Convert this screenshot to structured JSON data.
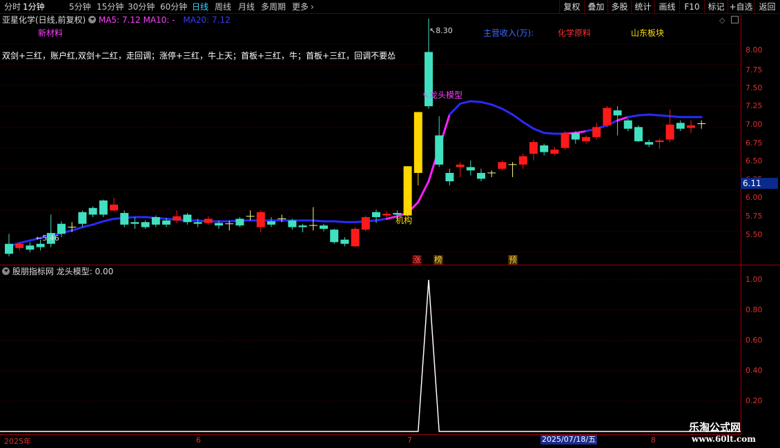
{
  "toolbar": {
    "periods": [
      "分时",
      "1分钟",
      "5分钟",
      "15分钟",
      "30分钟",
      "60分钟",
      "日线",
      "周线",
      "月线",
      "多周期",
      "更多"
    ],
    "active_period": "日线",
    "more_icon": "chevron-right-icon",
    "right_buttons": [
      "复权",
      "叠加",
      "多股",
      "统计",
      "画线",
      "F10",
      "标记",
      "+自选",
      "返回"
    ]
  },
  "main_panel": {
    "stock_title": "亚星化学(日线,前复权)",
    "ma5": "MA5: 7.12",
    "ma10": "MA10: -",
    "ma20": "MA20: 7.12",
    "tag_left": "新材料",
    "tags": [
      {
        "text": "主营收入(万):",
        "color": "#3a6bff"
      },
      {
        "text": "化学原料",
        "color": "#ff3030"
      },
      {
        "text": "山东板块",
        "color": "#ffe000"
      }
    ],
    "description": "双剑+三红，账户红,双剑+二红，走回调；涨停+三红，牛上天；首板+三红，牛；首板+三红，回调不要怂",
    "high_label": "8.30",
    "low_label": "5.46",
    "dragon_label": "龙头模型",
    "institution_label": "机构",
    "markers": [
      {
        "text": "涨",
        "bg": "#5a0000",
        "color": "#ff6060"
      },
      {
        "text": "榜",
        "bg": "#3a2a00",
        "color": "#ffd040"
      },
      {
        "text": "预",
        "bg": "#3a2a00",
        "color": "#ffd040"
      }
    ],
    "price_axis": [
      "8.00",
      "7.75",
      "7.50",
      "7.25",
      "7.00",
      "6.75",
      "6.50",
      "6.25",
      "6.00",
      "5.75",
      "5.50"
    ],
    "current_price": "6.11"
  },
  "indicator_panel": {
    "title": "股朋指标网",
    "indicator": "龙头模型: 0.00",
    "axis": [
      "1.00",
      "0.80",
      "0.60",
      "0.40",
      "0.20"
    ]
  },
  "x_axis": {
    "labels": [
      "2025年",
      "6",
      "7",
      "8"
    ],
    "selected_date": "2025/07/18/五"
  },
  "watermark": {
    "name": "乐淘公式网",
    "url": "www.60lt.com"
  },
  "chart_data": {
    "type": "candlestick",
    "ylim": [
      5.35,
      8.35
    ],
    "candles": [
      {
        "o": 5.6,
        "c": 5.48,
        "h": 5.72,
        "l": 5.45
      },
      {
        "o": 5.55,
        "c": 5.6,
        "h": 5.62,
        "l": 5.52
      },
      {
        "o": 5.58,
        "c": 5.53,
        "h": 5.62,
        "l": 5.5
      },
      {
        "o": 5.6,
        "c": 5.56,
        "h": 5.65,
        "l": 5.52
      },
      {
        "o": 5.73,
        "c": 5.6,
        "h": 5.95,
        "l": 5.56
      },
      {
        "o": 5.84,
        "c": 5.72,
        "h": 5.87,
        "l": 5.68
      },
      {
        "o": 5.8,
        "c": 5.8,
        "h": 5.86,
        "l": 5.74
      },
      {
        "o": 5.98,
        "c": 5.84,
        "h": 6.0,
        "l": 5.8
      },
      {
        "o": 6.03,
        "c": 5.95,
        "h": 6.05,
        "l": 5.92
      },
      {
        "o": 6.12,
        "c": 5.95,
        "h": 6.13,
        "l": 5.92
      },
      {
        "o": 6.0,
        "c": 6.07,
        "h": 6.15,
        "l": 5.99
      },
      {
        "o": 5.97,
        "c": 5.83,
        "h": 6.0,
        "l": 5.8
      },
      {
        "o": 5.86,
        "c": 5.84,
        "h": 5.92,
        "l": 5.78
      },
      {
        "o": 5.86,
        "c": 5.8,
        "h": 5.88,
        "l": 5.78
      },
      {
        "o": 5.92,
        "c": 5.83,
        "h": 5.94,
        "l": 5.8
      },
      {
        "o": 5.88,
        "c": 5.83,
        "h": 5.91,
        "l": 5.8
      },
      {
        "o": 5.88,
        "c": 5.93,
        "h": 6.0,
        "l": 5.85
      },
      {
        "o": 5.95,
        "c": 5.86,
        "h": 5.97,
        "l": 5.83
      },
      {
        "o": 5.86,
        "c": 5.84,
        "h": 5.9,
        "l": 5.8
      },
      {
        "o": 5.85,
        "c": 5.9,
        "h": 5.93,
        "l": 5.83
      },
      {
        "o": 5.85,
        "c": 5.82,
        "h": 5.88,
        "l": 5.78
      },
      {
        "o": 5.84,
        "c": 5.84,
        "h": 5.88,
        "l": 5.76
      },
      {
        "o": 5.9,
        "c": 5.82,
        "h": 5.92,
        "l": 5.8
      },
      {
        "o": 5.93,
        "c": 5.93,
        "h": 6.0,
        "l": 5.88
      },
      {
        "o": 5.8,
        "c": 5.98,
        "h": 6.0,
        "l": 5.74
      },
      {
        "o": 5.87,
        "c": 5.83,
        "h": 5.92,
        "l": 5.8
      },
      {
        "o": 5.9,
        "c": 5.9,
        "h": 5.95,
        "l": 5.86
      },
      {
        "o": 5.88,
        "c": 5.8,
        "h": 5.9,
        "l": 5.77
      },
      {
        "o": 5.82,
        "c": 5.8,
        "h": 5.84,
        "l": 5.74
      },
      {
        "o": 5.82,
        "c": 5.82,
        "h": 6.04,
        "l": 5.76
      },
      {
        "o": 5.82,
        "c": 5.78,
        "h": 5.84,
        "l": 5.75
      },
      {
        "o": 5.77,
        "c": 5.62,
        "h": 5.78,
        "l": 5.6
      },
      {
        "o": 5.65,
        "c": 5.6,
        "h": 5.68,
        "l": 5.57
      },
      {
        "o": 5.57,
        "c": 5.78,
        "h": 5.8,
        "l": 5.56
      },
      {
        "o": 5.77,
        "c": 5.92,
        "h": 5.94,
        "l": 5.75
      },
      {
        "o": 5.98,
        "c": 5.92,
        "h": 6.01,
        "l": 5.85
      },
      {
        "o": 5.94,
        "c": 5.96,
        "h": 5.99,
        "l": 5.9
      },
      {
        "o": 5.97,
        "c": 5.95,
        "h": 6.0,
        "l": 5.91
      },
      {
        "o": 5.94,
        "c": 6.53,
        "h": 6.53,
        "l": 5.93,
        "limit": true
      },
      {
        "o": 6.45,
        "c": 7.18,
        "h": 7.18,
        "l": 6.3,
        "limit": true
      },
      {
        "o": 7.9,
        "c": 7.25,
        "h": 8.3,
        "l": 7.22
      },
      {
        "o": 6.9,
        "c": 6.55,
        "h": 7.13,
        "l": 6.52
      },
      {
        "o": 6.45,
        "c": 6.35,
        "h": 6.5,
        "l": 6.3
      },
      {
        "o": 6.52,
        "c": 6.55,
        "h": 6.58,
        "l": 6.4
      },
      {
        "o": 6.52,
        "c": 6.48,
        "h": 6.6,
        "l": 6.42
      },
      {
        "o": 6.45,
        "c": 6.38,
        "h": 6.5,
        "l": 6.35
      },
      {
        "o": 6.45,
        "c": 6.45,
        "h": 6.48,
        "l": 6.4
      },
      {
        "o": 6.5,
        "c": 6.58,
        "h": 6.6,
        "l": 6.48
      },
      {
        "o": 6.55,
        "c": 6.55,
        "h": 6.58,
        "l": 6.4
      },
      {
        "o": 6.55,
        "c": 6.65,
        "h": 6.68,
        "l": 6.5
      },
      {
        "o": 6.68,
        "c": 6.82,
        "h": 6.85,
        "l": 6.6
      },
      {
        "o": 6.78,
        "c": 6.7,
        "h": 6.8,
        "l": 6.66
      },
      {
        "o": 6.68,
        "c": 6.73,
        "h": 6.76,
        "l": 6.66
      },
      {
        "o": 6.75,
        "c": 6.93,
        "h": 6.95,
        "l": 6.73
      },
      {
        "o": 6.93,
        "c": 6.85,
        "h": 6.95,
        "l": 6.8
      },
      {
        "o": 6.83,
        "c": 6.88,
        "h": 6.9,
        "l": 6.8
      },
      {
        "o": 6.88,
        "c": 7.0,
        "h": 7.05,
        "l": 6.85
      },
      {
        "o": 7.02,
        "c": 7.23,
        "h": 7.25,
        "l": 7.0
      },
      {
        "o": 7.2,
        "c": 7.14,
        "h": 7.25,
        "l": 6.9
      },
      {
        "o": 7.08,
        "c": 6.98,
        "h": 7.1,
        "l": 6.95
      },
      {
        "o": 7.0,
        "c": 6.83,
        "h": 7.02,
        "l": 6.82
      },
      {
        "o": 6.82,
        "c": 6.79,
        "h": 6.85,
        "l": 6.76
      },
      {
        "o": 6.82,
        "c": 6.84,
        "h": 6.86,
        "l": 6.74
      },
      {
        "o": 6.85,
        "c": 7.03,
        "h": 7.21,
        "l": 6.82
      },
      {
        "o": 7.05,
        "c": 6.98,
        "h": 7.08,
        "l": 6.95
      },
      {
        "o": 6.99,
        "c": 7.02,
        "h": 7.08,
        "l": 6.93
      },
      {
        "o": 7.04,
        "c": 7.04,
        "h": 7.08,
        "l": 6.98
      }
    ],
    "ma20": [
      5.57,
      5.61,
      5.64,
      5.67,
      5.7,
      5.73,
      5.76,
      5.8,
      5.83,
      5.87,
      5.9,
      5.91,
      5.92,
      5.92,
      5.91,
      5.9,
      5.89,
      5.88,
      5.88,
      5.87,
      5.87,
      5.87,
      5.88,
      5.88,
      5.88,
      5.88,
      5.88,
      5.88,
      5.88,
      5.88,
      5.87,
      5.87,
      5.86,
      5.86,
      5.87,
      5.88,
      5.9,
      5.93,
      5.97,
      6.1,
      6.35,
      6.75,
      7.15,
      7.28,
      7.31,
      7.3,
      7.27,
      7.22,
      7.15,
      7.06,
      6.98,
      6.93,
      6.92,
      6.92,
      6.93,
      6.95,
      6.98,
      7.02,
      7.08,
      7.12,
      7.14,
      7.15,
      7.14,
      7.13,
      7.12,
      7.12,
      7.12
    ],
    "ma20_magenta_ranges": [
      [
        36,
        42
      ],
      [
        53,
        55
      ],
      [
        58,
        59
      ]
    ],
    "indicator_values": [
      0,
      0,
      0,
      0,
      0,
      0,
      0,
      0,
      0,
      0,
      0,
      0,
      0,
      0,
      0,
      0,
      0,
      0,
      0,
      0,
      0,
      0,
      0,
      0,
      0,
      0,
      0,
      0,
      0,
      0,
      0,
      0,
      0,
      0,
      0,
      0,
      0,
      0,
      0,
      0,
      1,
      0,
      0,
      0,
      0,
      0,
      0,
      0,
      0,
      0,
      0,
      0,
      0,
      0,
      0,
      0,
      0,
      0,
      0,
      0,
      0,
      0,
      0,
      0,
      0,
      0,
      0
    ],
    "indicator_ylim": [
      0,
      1
    ]
  }
}
